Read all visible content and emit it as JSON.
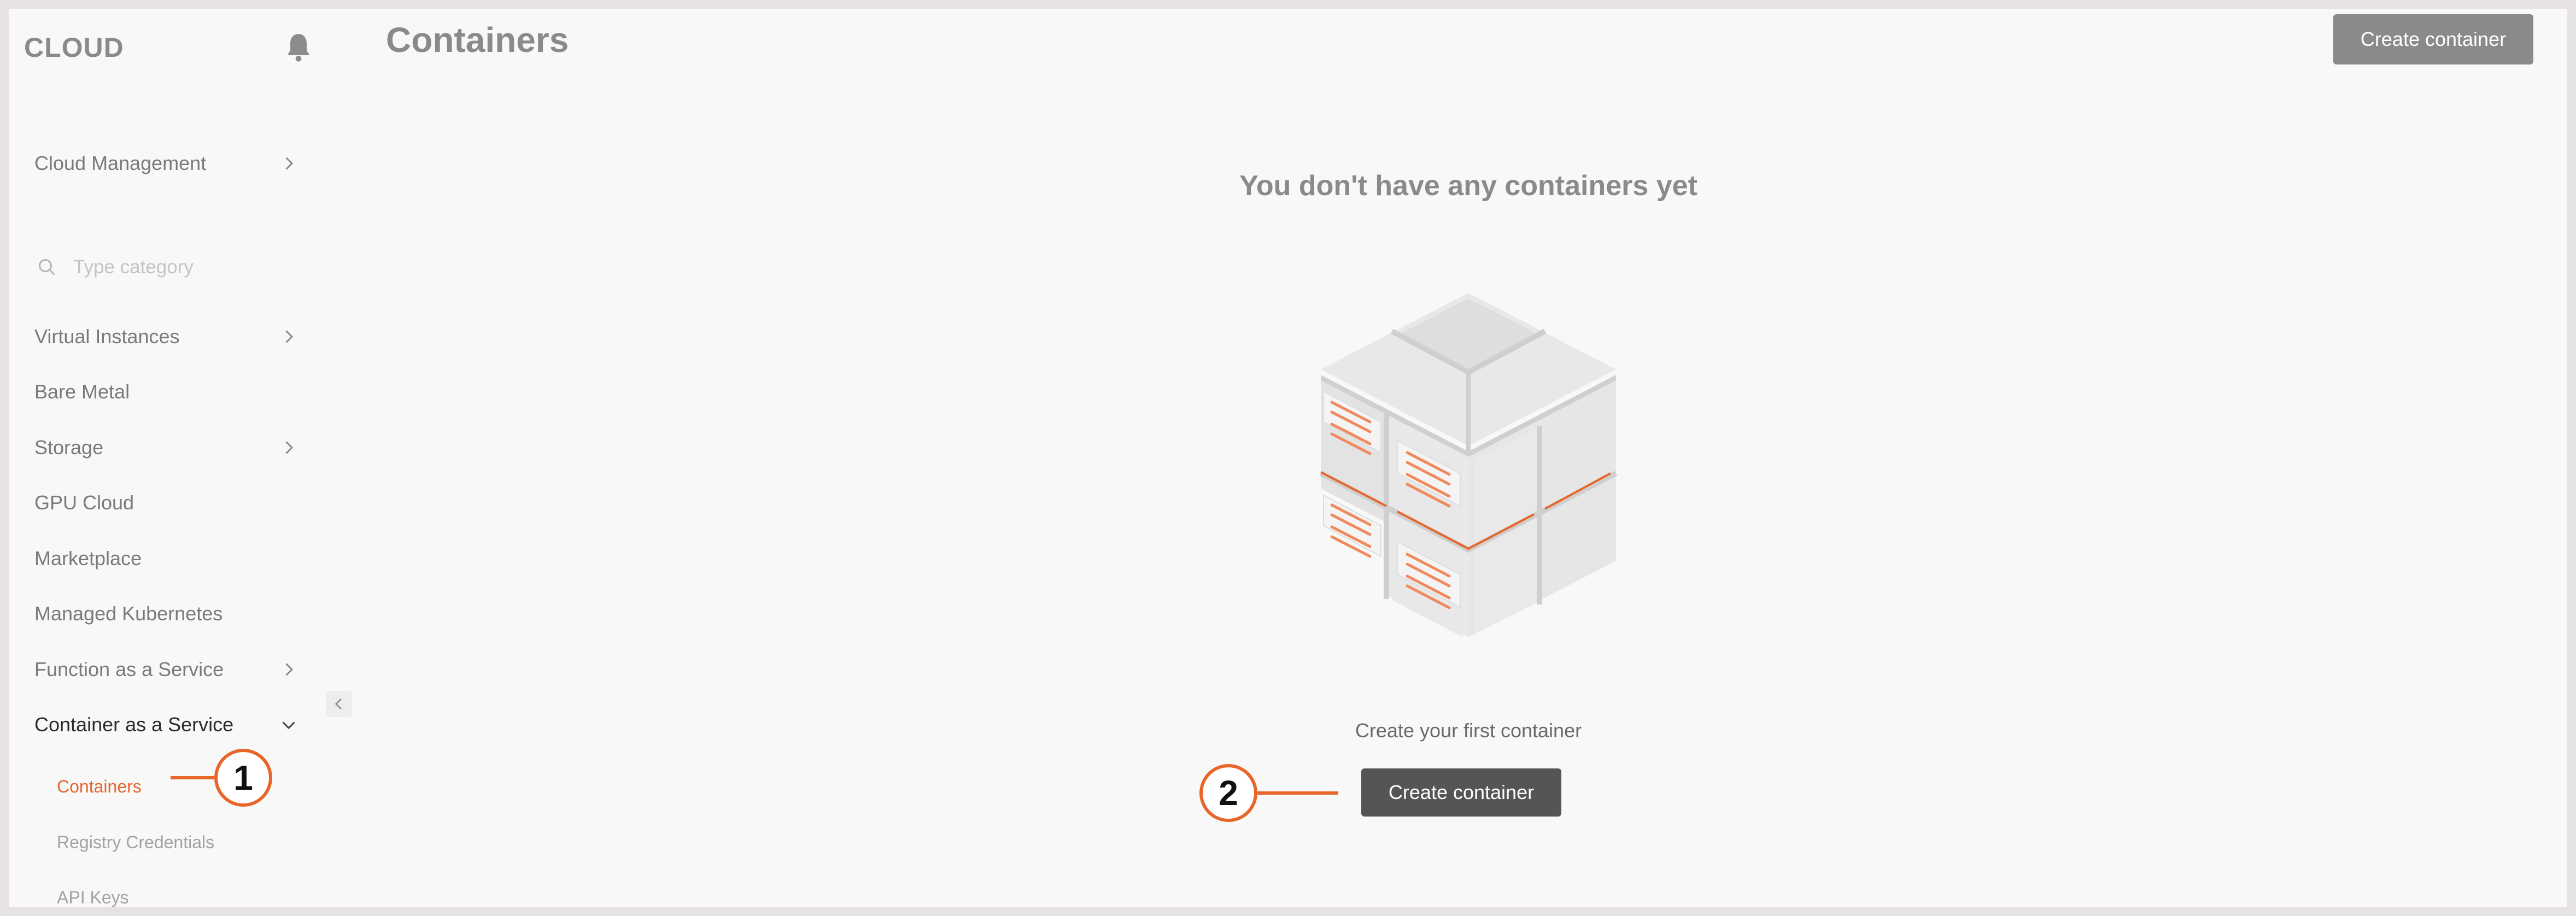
{
  "app": {
    "logo": "CLOUD",
    "page_title": "Containers"
  },
  "header": {
    "create_button_label": "Create container"
  },
  "sidebar": {
    "cloud_management": "Cloud Management",
    "search_placeholder": "Type category",
    "items": [
      {
        "label": "Virtual Instances",
        "has_chevron": true
      },
      {
        "label": "Bare Metal",
        "has_chevron": false
      },
      {
        "label": "Storage",
        "has_chevron": true
      },
      {
        "label": "GPU Cloud",
        "has_chevron": false
      },
      {
        "label": "Marketplace",
        "has_chevron": false
      },
      {
        "label": "Managed Kubernetes",
        "has_chevron": false
      },
      {
        "label": "Function as a Service",
        "has_chevron": true
      },
      {
        "label": "Container as a Service",
        "has_chevron": true,
        "expanded": true
      }
    ],
    "sub_items": [
      {
        "label": "Containers",
        "active": true
      },
      {
        "label": "Registry Credentials",
        "active": false
      },
      {
        "label": "API Keys",
        "active": false
      }
    ]
  },
  "empty_state": {
    "title": "You don't have any containers yet",
    "subtitle": "Create your first container",
    "button_label": "Create container"
  },
  "callouts": [
    {
      "number": "1"
    },
    {
      "number": "2"
    }
  ],
  "colors": {
    "accent": "#e8662a",
    "primary_button": "#555555",
    "header_button": "#8a8a8a"
  }
}
